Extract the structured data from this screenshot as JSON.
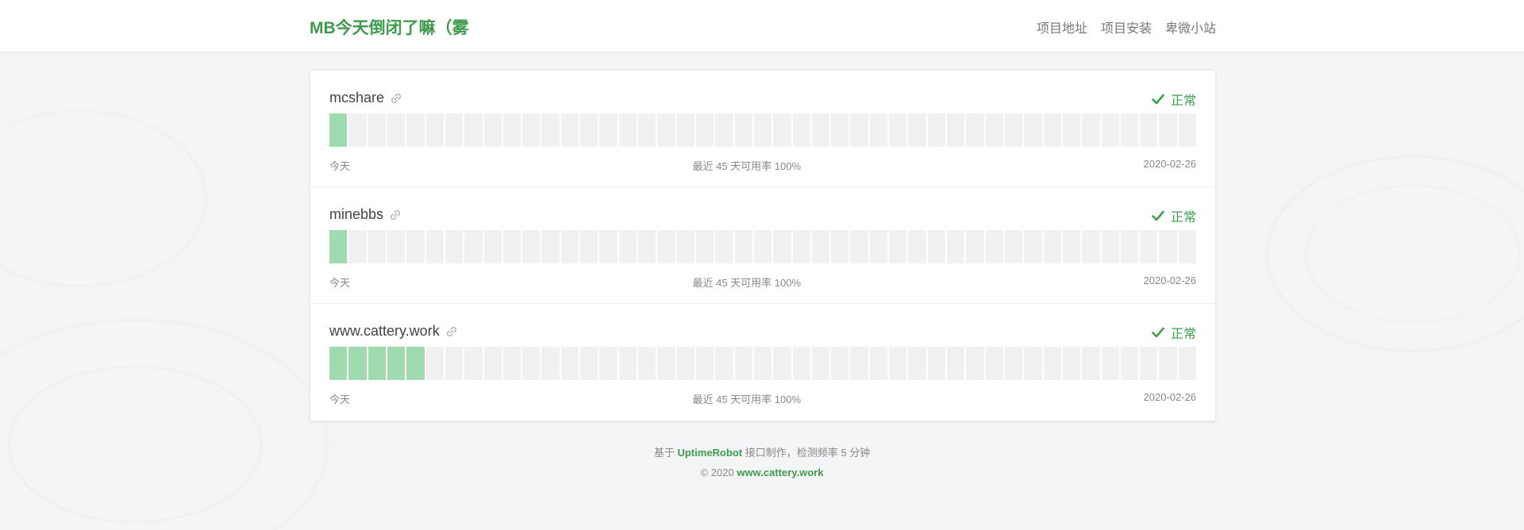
{
  "header": {
    "brand": "MB今天倒闭了嘛（雾",
    "nav": [
      "项目地址",
      "项目安装",
      "卑微小站"
    ]
  },
  "colors": {
    "accent": "#3d9b4d",
    "bar_up": "#9fdbae",
    "bar_empty": "#f1f1f1",
    "status_ok": "#3aa24b"
  },
  "monitors": [
    {
      "name": "mcshare",
      "status": "正常",
      "bars_total": 45,
      "bars_up": 1,
      "left_label": "今天",
      "center_label": "最近 45 天可用率 100%",
      "right_label": "2020-02-26"
    },
    {
      "name": "minebbs",
      "status": "正常",
      "bars_total": 45,
      "bars_up": 1,
      "left_label": "今天",
      "center_label": "最近 45 天可用率 100%",
      "right_label": "2020-02-26"
    },
    {
      "name": "www.cattery.work",
      "status": "正常",
      "bars_total": 45,
      "bars_up": 5,
      "left_label": "今天",
      "center_label": "最近 45 天可用率 100%",
      "right_label": "2020-02-26"
    }
  ],
  "footer": {
    "line1_prefix": "基于",
    "line1_link": "UptimeRobot",
    "line1_suffix": "接口制作，检测频率 5 分钟",
    "line2_prefix": "© 2020",
    "line2_link": "www.cattery.work"
  }
}
